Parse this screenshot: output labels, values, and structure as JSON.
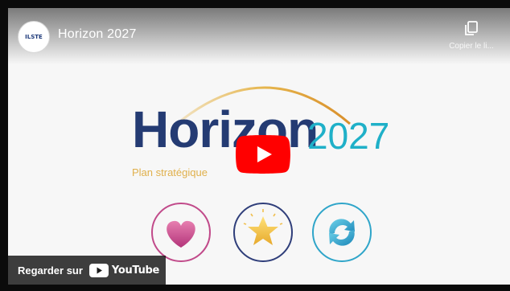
{
  "player": {
    "title": "Horizon 2027",
    "channel_logo_text": "ILSTE",
    "copy_link_label": "Copier le li...",
    "watch_on_label": "Regarder sur",
    "youtube_label": "YouTube"
  },
  "thumbnail": {
    "brand_word": "Horizon",
    "brand_year": "2027",
    "subtitle": "Plan stratégique",
    "icons": [
      "heart-icon",
      "star-icon",
      "refresh-icon"
    ]
  },
  "colors": {
    "brand_navy": "#243b73",
    "brand_cyan": "#1fb0c8",
    "accent_gold": "#e0b04c",
    "youtube_red": "#ff0000"
  }
}
